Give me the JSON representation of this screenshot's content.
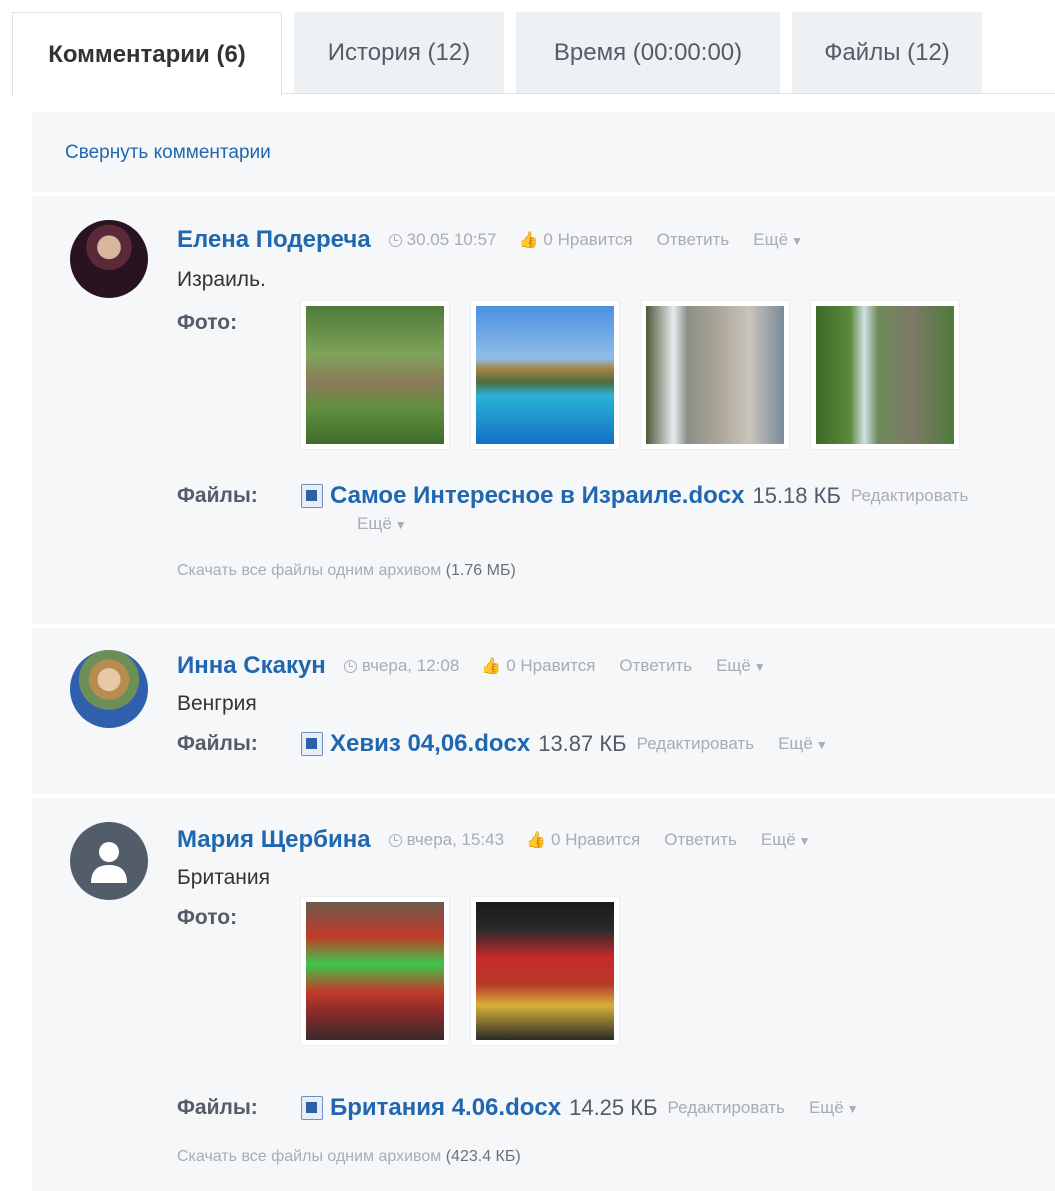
{
  "tabs": [
    {
      "label": "Комментарии (6)",
      "active": true
    },
    {
      "label": "История (12)"
    },
    {
      "label": "Время (00:00:00)"
    },
    {
      "label": "Файлы (12)"
    }
  ],
  "collapse_label": "Свернуть комментарии",
  "photo_label": "Фото:",
  "files_label": "Файлы:",
  "like_label": "0 Нравится",
  "reply_label": "Ответить",
  "more_label": "Ещё",
  "edit_label": "Редактировать",
  "comments": [
    {
      "author": "Елена Подереча",
      "time": "30.05 10:57",
      "text": "Израиль.",
      "photos": [
        "garden",
        "pool",
        "waterfall-canyon",
        "waterfall-green"
      ],
      "file": {
        "name": "Самое Интересное в Израиле.docx",
        "size": "15.18 КБ"
      },
      "download_text": "Скачать все файлы одним архивом",
      "download_size": "(1.76 МБ)"
    },
    {
      "author": "Инна Скакун",
      "time": "вчера, 12:08",
      "text": "Венгрия",
      "file": {
        "name": "Хевиз 04,06.docx",
        "size": "13.87 КБ"
      }
    },
    {
      "author": "Мария Щербина",
      "time": "вчера, 15:43",
      "text": "Британия",
      "photos": [
        "royal-family",
        "royal-guards"
      ],
      "file": {
        "name": "Британия 4.06.docx",
        "size": "14.25 КБ"
      },
      "download_text": "Скачать все файлы одним архивом",
      "download_size": "(423.4 КБ)"
    }
  ],
  "colors": {
    "link": "#2067b0",
    "panel": "#f5f7f9",
    "muted": "#a8adb4"
  }
}
